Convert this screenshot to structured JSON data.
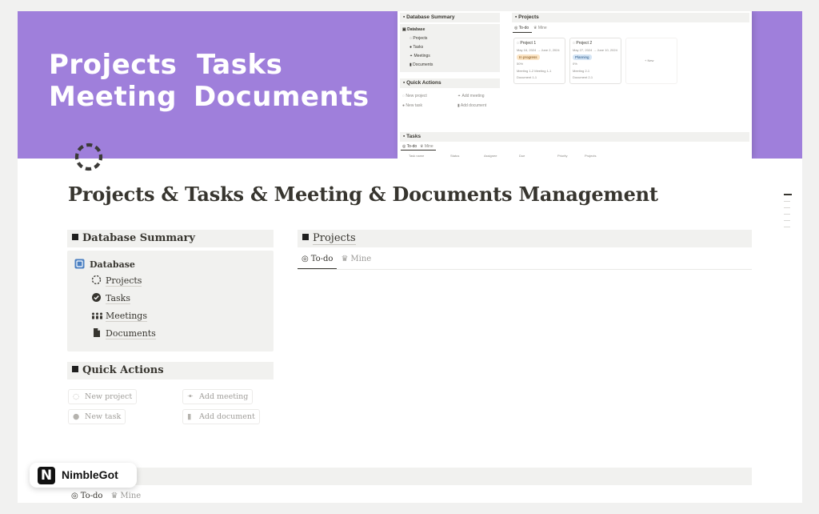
{
  "cover": {
    "words": [
      "Projects",
      "Tasks",
      "Meeting",
      "Documents"
    ],
    "background": "#9f7fdb",
    "preview": {
      "db_summary": "Database Summary",
      "database": "Database",
      "items": [
        "Projects",
        "Tasks",
        "Meetings",
        "Documents"
      ],
      "quick_actions": "Quick Actions",
      "qa_items": [
        "New project",
        "Add meeting",
        "New task",
        "Add document"
      ],
      "projects": "Projects",
      "tabs": [
        "To-do",
        "Mine"
      ],
      "card1": {
        "name": "Project 1",
        "dates": "May 16, 2024 → June 2, 2024",
        "status": "In progress",
        "pct": "50%",
        "meet": "Meeting 1-2  Meeting 1-1",
        "doc": "Document 1-1"
      },
      "card2": {
        "name": "Project 2",
        "dates": "May 27, 2024 → June 10, 2024",
        "status": "Planning",
        "pct": "0%",
        "meet": "Meeting 2-1",
        "doc": "Document 2-1"
      },
      "new": "+ New",
      "tasks": "Tasks",
      "task_cols": [
        "Task name",
        "Status",
        "Assignee",
        "Due",
        "Priority",
        "Projects"
      ]
    }
  },
  "page": {
    "icon": "dashed-circle-icon",
    "title": "Projects & Tasks & Meeting & Documents Management"
  },
  "db_summary": {
    "header": "Database Summary",
    "title": "Database",
    "items": [
      {
        "label": "Projects",
        "icon": "dashed-circle-icon"
      },
      {
        "label": "Tasks",
        "icon": "check-circle-icon"
      },
      {
        "label": "Meetings",
        "icon": "people-icon"
      },
      {
        "label": "Documents",
        "icon": "document-icon"
      }
    ]
  },
  "quick_actions": {
    "header": "Quick Actions",
    "buttons": [
      "New project",
      "Add meeting",
      "New task",
      "Add document"
    ]
  },
  "projects": {
    "header": "Projects",
    "tabs": [
      "To-do",
      "Mine"
    ]
  },
  "tasks": {
    "tabs": [
      "To-do",
      "Mine"
    ]
  },
  "brand": {
    "logo_letter": "N",
    "name": "NimbleGot"
  }
}
